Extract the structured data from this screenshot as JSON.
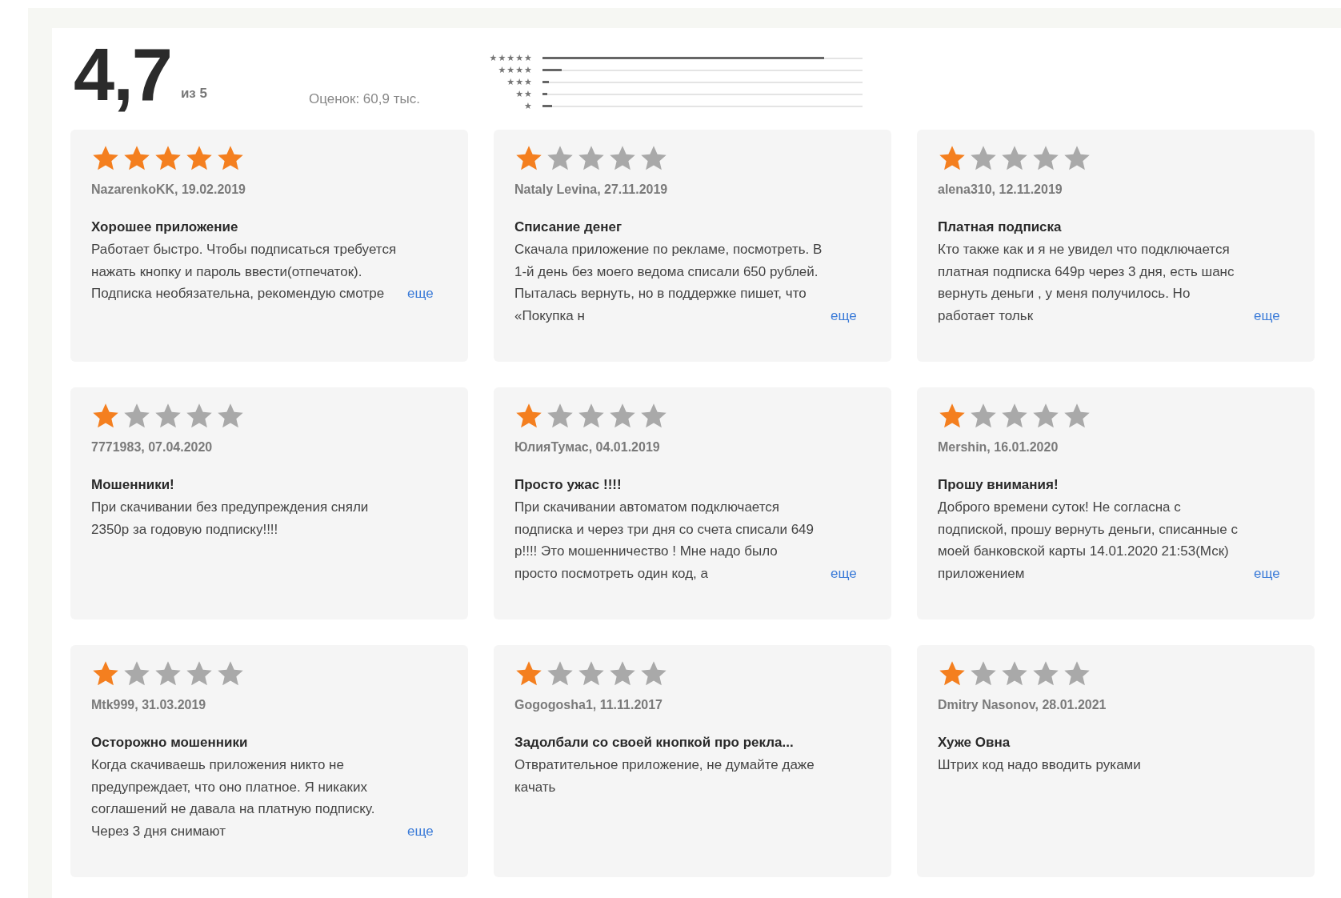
{
  "summary": {
    "rating": "4,7",
    "out_of": "из 5",
    "count": "Оценок: 60,9 тыс."
  },
  "histogram": [
    {
      "label": "★★★★★",
      "level": 0.88
    },
    {
      "label": "★★★★",
      "level": 0.06
    },
    {
      "label": "★★★",
      "level": 0.02
    },
    {
      "label": "★★",
      "level": 0.015
    },
    {
      "label": "★",
      "level": 0.03
    }
  ],
  "reviews": [
    {
      "stars": 5,
      "author": "NazarenkoKK, 19.02.2019",
      "title": "Хорошее приложение",
      "body": "Работает быстро. Чтобы подписаться требуется нажать кнопку и пароль ввести(отпечаток). Подписка необязательна, рекомендую смотре",
      "more": "еще"
    },
    {
      "stars": 1,
      "author": "Nataly Levina, 27.11.2019",
      "title": "Списание денег",
      "body": "Скачала приложение по рекламе, посмотреть. В 1-й день без моего ведома списали 650 рублей. Пыталась вернуть, но в поддержке пишет, что «Покупка н",
      "more": "еще"
    },
    {
      "stars": 1,
      "author": "alena310, 12.11.2019",
      "title": "Платная подписка",
      "body": "Кто также как и я не увидел что подключается платная подписка 649р через 3 дня, есть шанс вернуть деньги , у меня получилось. Но работает тольк",
      "more": "еще"
    },
    {
      "stars": 1,
      "author": "7771983, 07.04.2020",
      "title": "Мошенники!",
      "body": "При скачивании без предупреждения сняли 2350р за годовую подписку!!!!"
    },
    {
      "stars": 1,
      "author": "ЮлияТумас, 04.01.2019",
      "title": "Просто ужас !!!!",
      "body": "При скачивании автоматом подключается подписка и через три дня со счета списали 649 р!!!! Это мошенничество ! Мне надо было просто посмотреть один код, а",
      "more": "еще"
    },
    {
      "stars": 1,
      "author": "Mershin, 16.01.2020",
      "title": "Прошу внимания!",
      "body": "Доброго времени суток! Не согласна с подпиской, прошу вернуть деньги, списанные с моей банковской карты 14.01.2020 21:53(Мск) приложением",
      "more": "еще"
    },
    {
      "stars": 1,
      "author": "Mtk999, 31.03.2019",
      "title": "Осторожно мошенники",
      "body": "Когда скачиваешь приложения никто не предупреждает, что оно платное. Я никаких соглашений не давала на платную подписку. Через 3 дня снимают",
      "more": "еще"
    },
    {
      "stars": 1,
      "author": "Gogogosha1, 11.11.2017",
      "title": "Задолбали со своей кнопкой про рекла...",
      "body": "Отвратительное приложение, не думайте даже качать"
    },
    {
      "stars": 1,
      "author": "Dmitry Nasonov, 28.01.2021",
      "title": "Хуже Овна",
      "body": "Штрих код надо вводить руками"
    }
  ]
}
